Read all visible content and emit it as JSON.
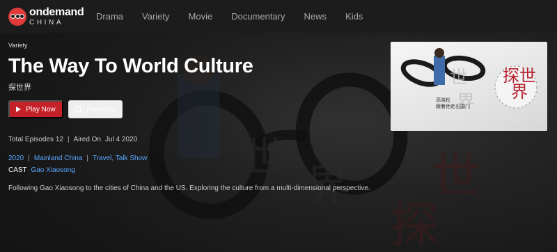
{
  "brand": {
    "name_top": "ondemand",
    "name_bottom": "CHINA",
    "accent": "#e23b3b"
  },
  "nav": {
    "items": [
      "Drama",
      "Variety",
      "Movie",
      "Documentary",
      "News",
      "Kids"
    ]
  },
  "show": {
    "category": "Variety",
    "title": "The Way To World Culture",
    "subtitle": "探世界",
    "play_label": "Play Now",
    "favorites_label": "Favorites",
    "total_episodes": "Total Episodes 12",
    "aired_on_label": "Aired On",
    "aired_on_value": "Jul 4 2020",
    "year": "2020",
    "region": "Mainland China",
    "genre": "Travel, Talk Show",
    "cast_label": "CAST",
    "cast_value": "Gao Xiaosong",
    "description": "Following Gao Xiaosong to the cities of China and the US. Exploring the culture from a multi-dimensional perspective.",
    "thumbnail_title": "探世界",
    "thumbnail_caption_name": "高晓松",
    "thumbnail_caption_line": "跟着他走出国门"
  },
  "colors": {
    "play_button": "#c42129",
    "link": "#5aa7ff",
    "nav_bg": "#1c1c1c"
  }
}
